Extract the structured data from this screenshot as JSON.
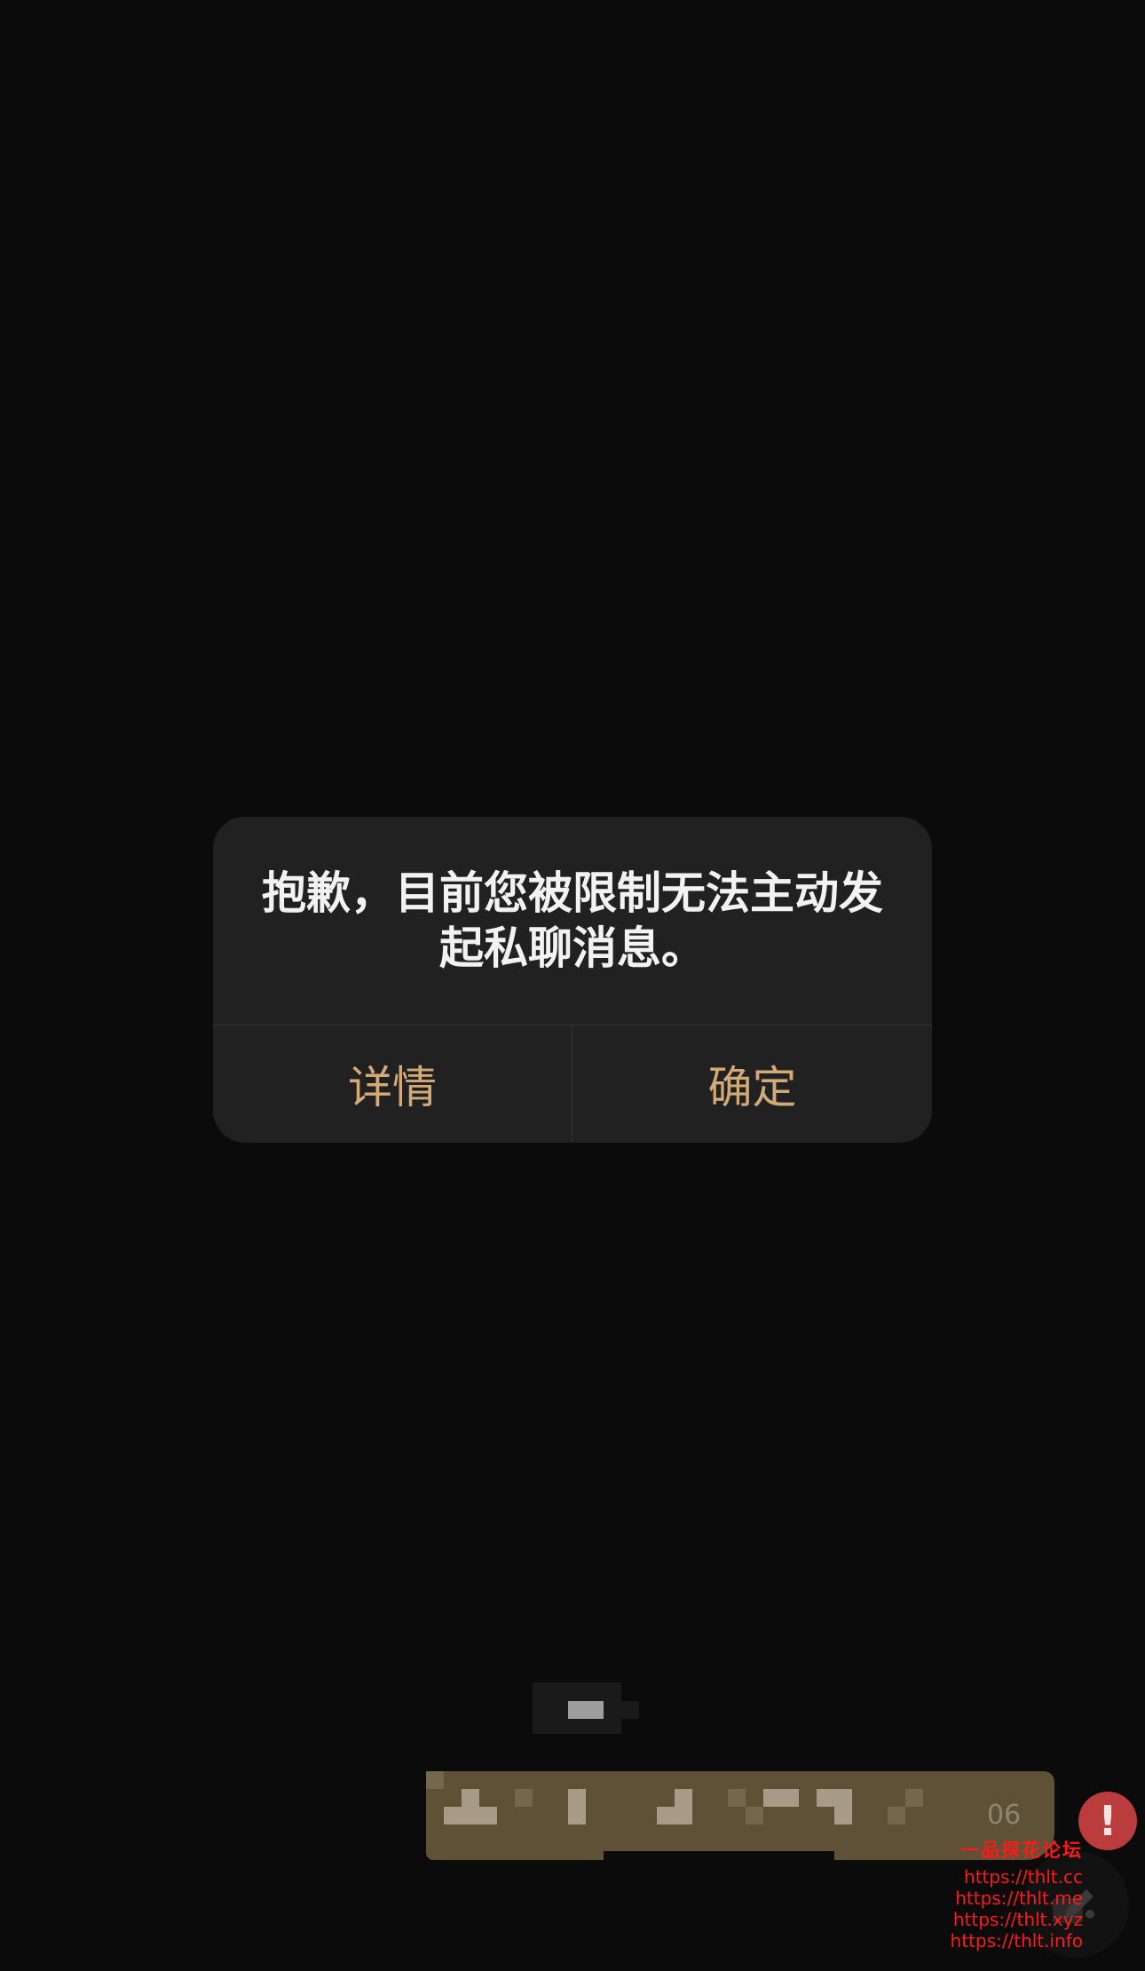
{
  "dialog": {
    "message": "抱歉，目前您被限制无法主动发起私聊消息。",
    "details_label": "详情",
    "confirm_label": "确定"
  },
  "background_chat": {
    "message_time": "06",
    "error_icon": "!"
  },
  "watermark": {
    "title": "一品探花论坛",
    "lines": [
      "https://thlt.cc",
      "https://thlt.me",
      "https://thlt.xyz",
      "https://thlt.info"
    ]
  },
  "colors": {
    "background": "#0b0b0b",
    "dialog_bg": "#212121",
    "accent_button": "#d2aa78",
    "error_red": "#bb3c3c",
    "watermark_red": "#ff1a1a"
  }
}
